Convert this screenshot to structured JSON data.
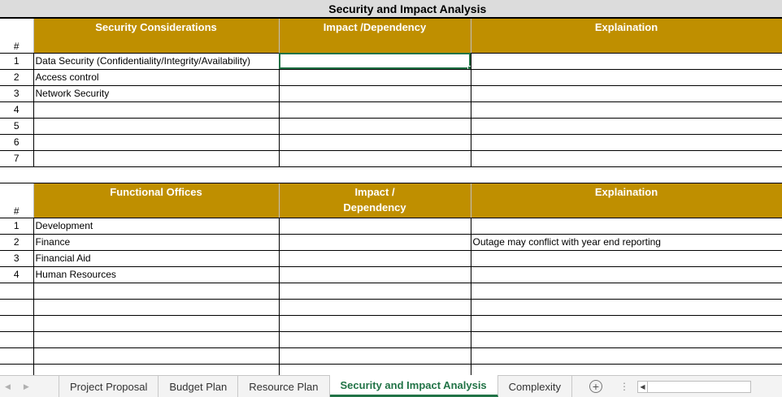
{
  "sheet": {
    "title": "Security and Impact Analysis",
    "section1": {
      "num_header": "#",
      "headers": [
        "Security Considerations",
        "Impact /Dependency",
        "Explaination"
      ],
      "rows": [
        {
          "num": "1",
          "item": "Data Security (Confidentiality/Integrity/Availability)",
          "impact": "",
          "explanation": ""
        },
        {
          "num": "2",
          "item": "Access control",
          "impact": "",
          "explanation": ""
        },
        {
          "num": "3",
          "item": "Network Security",
          "impact": "",
          "explanation": ""
        },
        {
          "num": "4",
          "item": "",
          "impact": "",
          "explanation": ""
        },
        {
          "num": "5",
          "item": "",
          "impact": "",
          "explanation": ""
        },
        {
          "num": "6",
          "item": "",
          "impact": "",
          "explanation": ""
        },
        {
          "num": "7",
          "item": "",
          "impact": "",
          "explanation": ""
        }
      ]
    },
    "section2": {
      "num_header": "#",
      "headers": [
        "Functional Offices",
        "Impact /",
        "Dependency",
        "Explaination"
      ],
      "rows": [
        {
          "num": "1",
          "item": "Development",
          "impact": "",
          "explanation": ""
        },
        {
          "num": "2",
          "item": "Finance",
          "impact": "",
          "explanation": "Outage may conflict with year end reporting"
        },
        {
          "num": "3",
          "item": "Financial Aid",
          "impact": "",
          "explanation": ""
        },
        {
          "num": "4",
          "item": "Human Resources",
          "impact": "",
          "explanation": ""
        },
        {
          "num": "",
          "item": "",
          "impact": "",
          "explanation": ""
        },
        {
          "num": "",
          "item": "",
          "impact": "",
          "explanation": ""
        },
        {
          "num": "",
          "item": "",
          "impact": "",
          "explanation": ""
        },
        {
          "num": "",
          "item": "",
          "impact": "",
          "explanation": ""
        },
        {
          "num": "",
          "item": "",
          "impact": "",
          "explanation": ""
        },
        {
          "num": "",
          "item": "",
          "impact": "",
          "explanation": ""
        }
      ]
    }
  },
  "tabs": {
    "items": [
      "Project Proposal",
      "Budget Plan",
      "Resource Plan",
      "Security and Impact Analysis",
      "Complexity"
    ],
    "active_index": 3,
    "add_icon": "plus-circle-icon"
  },
  "colors": {
    "header_gold": "#bf8f00",
    "title_bg": "#dcdcdc",
    "active_tab": "#217346"
  }
}
